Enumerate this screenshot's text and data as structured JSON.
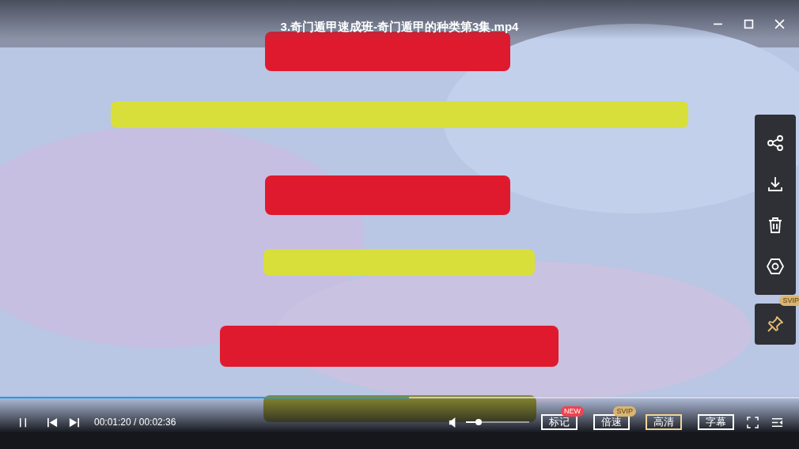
{
  "window": {
    "title": "3.奇门遁甲速成班-奇门遁甲的种类第3集.mp4"
  },
  "pin": {
    "badge": "SVIP"
  },
  "progress": {
    "level": 0.512
  },
  "time": "00:01:20 / 00:02:36",
  "volume": {
    "level": 0.2
  },
  "buttons": [
    {
      "label": "标记",
      "badge": {
        "text": "NEW",
        "color": "#f0434f"
      },
      "selected": false
    },
    {
      "label": "倍速",
      "badge": {
        "text": "SVIP",
        "color": "#d9b572"
      },
      "selected": false
    },
    {
      "label": "高清",
      "selected": true
    },
    {
      "label": "字幕",
      "selected": false
    }
  ]
}
